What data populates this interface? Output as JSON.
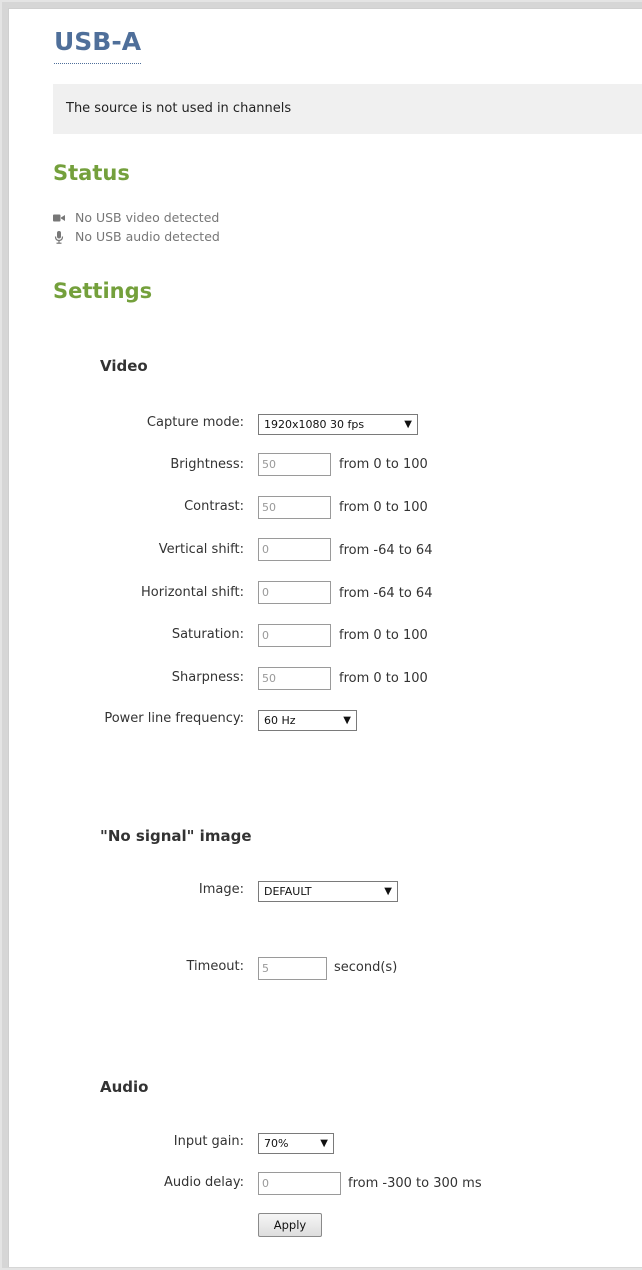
{
  "page_title": "USB-A",
  "info_message": "The source is not used in channels",
  "status": {
    "title": "Status",
    "items": [
      {
        "icon": "video-camera-icon",
        "text": "No USB video detected"
      },
      {
        "icon": "microphone-icon",
        "text": "No USB audio detected"
      }
    ]
  },
  "settings": {
    "title": "Settings",
    "video": {
      "title": "Video",
      "capture_mode": {
        "label": "Capture mode:",
        "value": "1920x1080 30 fps"
      },
      "brightness": {
        "label": "Brightness:",
        "value": "50",
        "range": "from 0 to 100"
      },
      "contrast": {
        "label": "Contrast:",
        "value": "50",
        "range": "from 0 to 100"
      },
      "vertical_shift": {
        "label": "Vertical shift:",
        "value": "0",
        "range": "from -64 to 64"
      },
      "horizontal_shift": {
        "label": "Horizontal shift:",
        "value": "0",
        "range": "from -64 to 64"
      },
      "saturation": {
        "label": "Saturation:",
        "value": "0",
        "range": "from 0 to 100"
      },
      "sharpness": {
        "label": "Sharpness:",
        "value": "50",
        "range": "from 0 to 100"
      },
      "power_line_frequency": {
        "label": "Power line frequency:",
        "value": "60 Hz"
      }
    },
    "no_signal": {
      "title": "\"No signal\" image",
      "image": {
        "label": "Image:",
        "value": "DEFAULT"
      },
      "timeout": {
        "label": "Timeout:",
        "value": "5",
        "unit": "second(s)"
      }
    },
    "audio": {
      "title": "Audio",
      "input_gain": {
        "label": "Input gain:",
        "value": "70%"
      },
      "audio_delay": {
        "label": "Audio delay:",
        "value": "0",
        "range": "from -300 to 300 ms"
      }
    },
    "apply_label": "Apply"
  },
  "colors": {
    "title_blue": "#4f6f9a",
    "section_green": "#74a03c",
    "info_bg": "#f0f0f0"
  }
}
